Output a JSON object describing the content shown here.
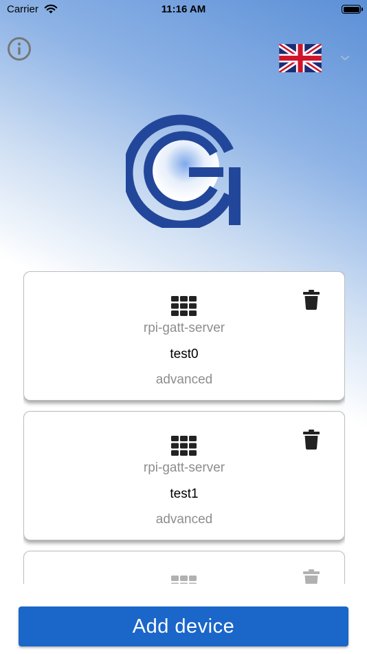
{
  "status_bar": {
    "carrier": "Carrier",
    "time": "11:16 AM",
    "wifi_icon": "wifi-icon",
    "battery_icon": "battery-icon"
  },
  "header": {
    "info_icon": "info-icon",
    "language_flag_icon": "uk-flag-icon",
    "language_chevron_icon": "chevron-down-icon"
  },
  "logo": {
    "icon": "g-logo"
  },
  "devices": [
    {
      "server": "rpi-gatt-server",
      "name": "test0",
      "mode": "advanced",
      "grid_icon": "grid-icon",
      "delete_icon": "trash-icon"
    },
    {
      "server": "rpi-gatt-server",
      "name": "test1",
      "mode": "advanced",
      "grid_icon": "grid-icon",
      "delete_icon": "trash-icon"
    },
    {
      "server": "",
      "name": "",
      "mode": "",
      "grid_icon": "grid-icon",
      "delete_icon": "trash-icon"
    }
  ],
  "footer": {
    "add_device_label": "Add device"
  },
  "colors": {
    "accent": "#1b66c9",
    "logo_blue": "#22479a",
    "muted_text": "#8d8d8d"
  }
}
